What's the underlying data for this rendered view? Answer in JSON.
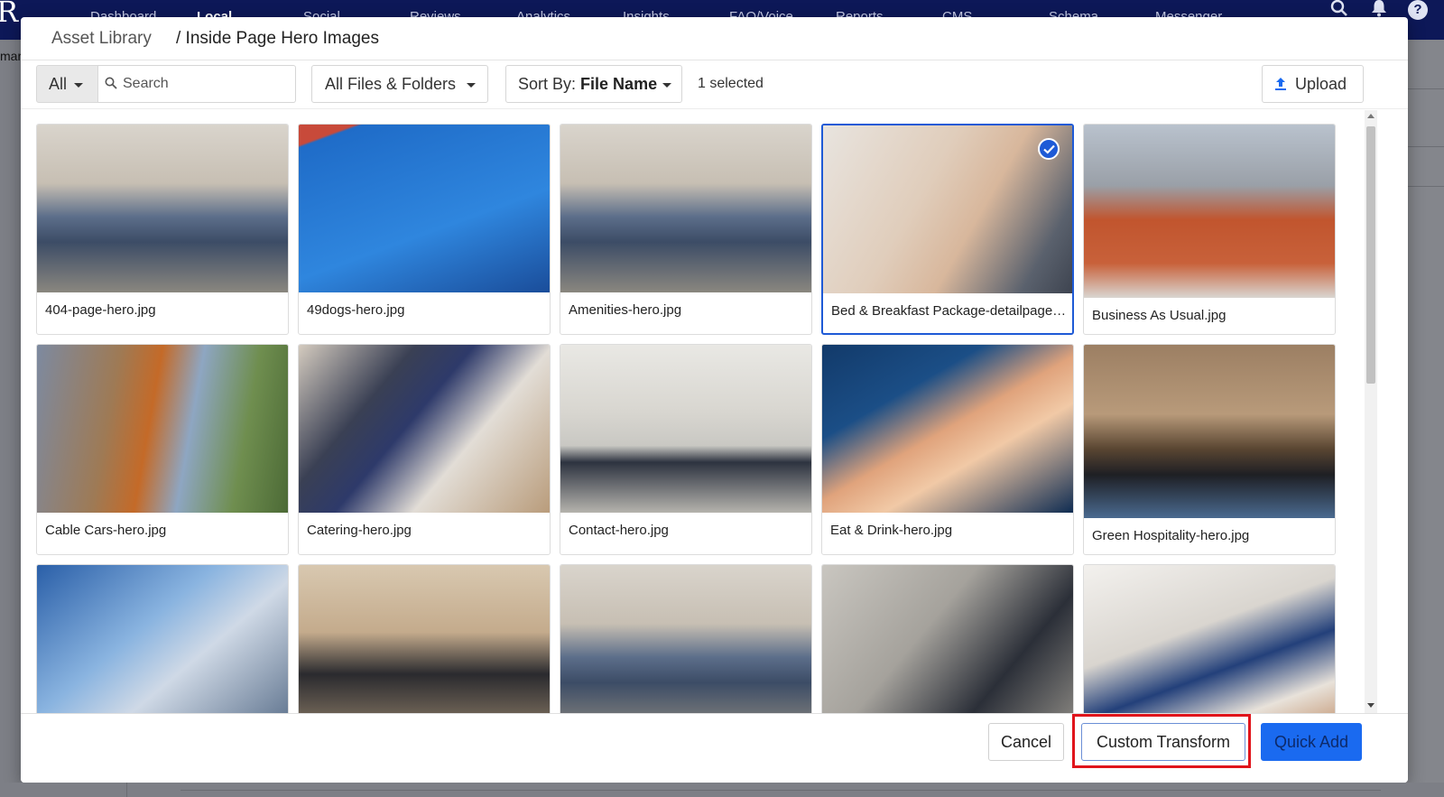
{
  "app_nav": {
    "items": [
      "Dashboard",
      "Local",
      "Social",
      "Reviews",
      "Analytics",
      "Insights",
      "FAQ/Voice",
      "Reports",
      "CMS",
      "Schema",
      "Messenger"
    ],
    "active": "Local",
    "background_fragment": "mar"
  },
  "breadcrumb": {
    "root": "Asset Library",
    "current": "/ Inside Page Hero Images"
  },
  "toolbar": {
    "filter_label": "All",
    "search_placeholder": "Search",
    "folders_label": "All Files & Folders",
    "sort_prefix": "Sort By:",
    "sort_value": "File Name",
    "selected_count": "1 selected",
    "upload_label": "Upload"
  },
  "assets": [
    {
      "name": "404-page-hero.jpg",
      "selected": false
    },
    {
      "name": "49dogs-hero.jpg",
      "selected": false
    },
    {
      "name": "Amenities-hero.jpg",
      "selected": false
    },
    {
      "name": "Bed & Breakfast Package-detailpage-hero.jpg",
      "selected": true
    },
    {
      "name": "Business As Usual.jpg",
      "selected": false
    },
    {
      "name": "Cable Cars-hero.jpg",
      "selected": false
    },
    {
      "name": "Catering-hero.jpg",
      "selected": false
    },
    {
      "name": "Contact-hero.jpg",
      "selected": false
    },
    {
      "name": "Eat & Drink-hero.jpg",
      "selected": false
    },
    {
      "name": "Green Hospitality-hero.jpg",
      "selected": false
    },
    {
      "name": "",
      "selected": false
    },
    {
      "name": "",
      "selected": false
    },
    {
      "name": "",
      "selected": false
    },
    {
      "name": "",
      "selected": false
    },
    {
      "name": "",
      "selected": false
    }
  ],
  "footer": {
    "cancel_label": "Cancel",
    "custom_transform_label": "Custom Transform",
    "quick_add_label": "Quick Add"
  },
  "colors": {
    "nav_bg": "#0d1858",
    "accent_blue": "#1a6af0",
    "selected_border": "#1e5ad6",
    "highlight_red": "#e0141b"
  },
  "icons": {
    "search": "search-icon",
    "bell": "bell-icon",
    "help": "help-icon",
    "upload": "upload-icon",
    "check": "check-icon",
    "caret": "caret-down-icon"
  }
}
